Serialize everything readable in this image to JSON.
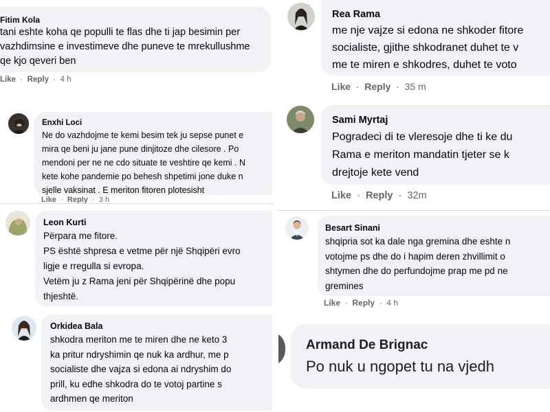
{
  "comments": [
    {
      "name": "Fitim Kola",
      "lines": [
        "tani eshte koha qe populli te flas dhe ti jap besimin per",
        "vazhdimsine e investimeve dhe puneve te mrekullushme",
        "qe kjo qeveri ben"
      ],
      "like": "Like",
      "reply": "Reply",
      "time": "4 h"
    },
    {
      "name": "Enxhi Loci",
      "lines": [
        "Ne do vazhdojme te kemi besim tek ju sepse punet e",
        "mira qe beni ju jane pune dinjitoze dhe cilesore . Po",
        "mendoni per ne ne cdo situate te veshtire qe kemi . N",
        "kete kohe pandemie po behesh shpetimi jone duke n",
        "sjelle vaksinat . E meriton fitoren plotesisht"
      ],
      "like": "Like",
      "reply": "Reply",
      "time": "3 h"
    },
    {
      "name": "Leon Kurti",
      "lines": [
        "Përpara me fitore.",
        "PS është shpresa e vetme për një Shqipëri evro",
        "ligje e rregulla si evropa.",
        "Vetëm ju z Rama jeni për Shqipërinë dhe popu",
        "thjeshtë."
      ]
    },
    {
      "name": "Orkidea Bala",
      "lines": [
        "shkodra meriton me te miren dhe ne keto 3",
        "ka pritur ndryshimin qe nuk ka ardhur, me p",
        "socialiste dhe vajza si edona ai ndryshim do",
        "prill, ku edhe shkodra do te votoj partine s",
        "ardhmen qe meriton"
      ]
    },
    {
      "name": "Rea Rama",
      "lines": [
        "me nje vajze si edona ne shkoder fitore",
        "socialiste, gjithe shkodranet duhet te v",
        "me te miren e shkodres, duhet te voto"
      ],
      "like": "Like",
      "reply": "Reply",
      "time": "35 m"
    },
    {
      "name": "Sami Myrtaj",
      "lines": [
        "Pogradeci di te vleresoje dhe ti ke du",
        "Rama e meriton mandatin tjeter se k",
        "drejtoje kete vend"
      ],
      "like": "Like",
      "reply": "Reply",
      "time": "32m"
    },
    {
      "name": "Besart Sinani",
      "lines": [
        "shqipria sot ka dale nga gremina dhe eshte n",
        "votojme ps dhe do i hapim deren zhvillimit o",
        "shtymen dhe do perfundojme prap me pd ne",
        "gremines"
      ],
      "like": "Like",
      "reply": "Reply",
      "time": "4 h"
    },
    {
      "name": "Armand De Brignac",
      "lines": [
        "Po nuk u ngopet tu na vjedh"
      ]
    }
  ]
}
